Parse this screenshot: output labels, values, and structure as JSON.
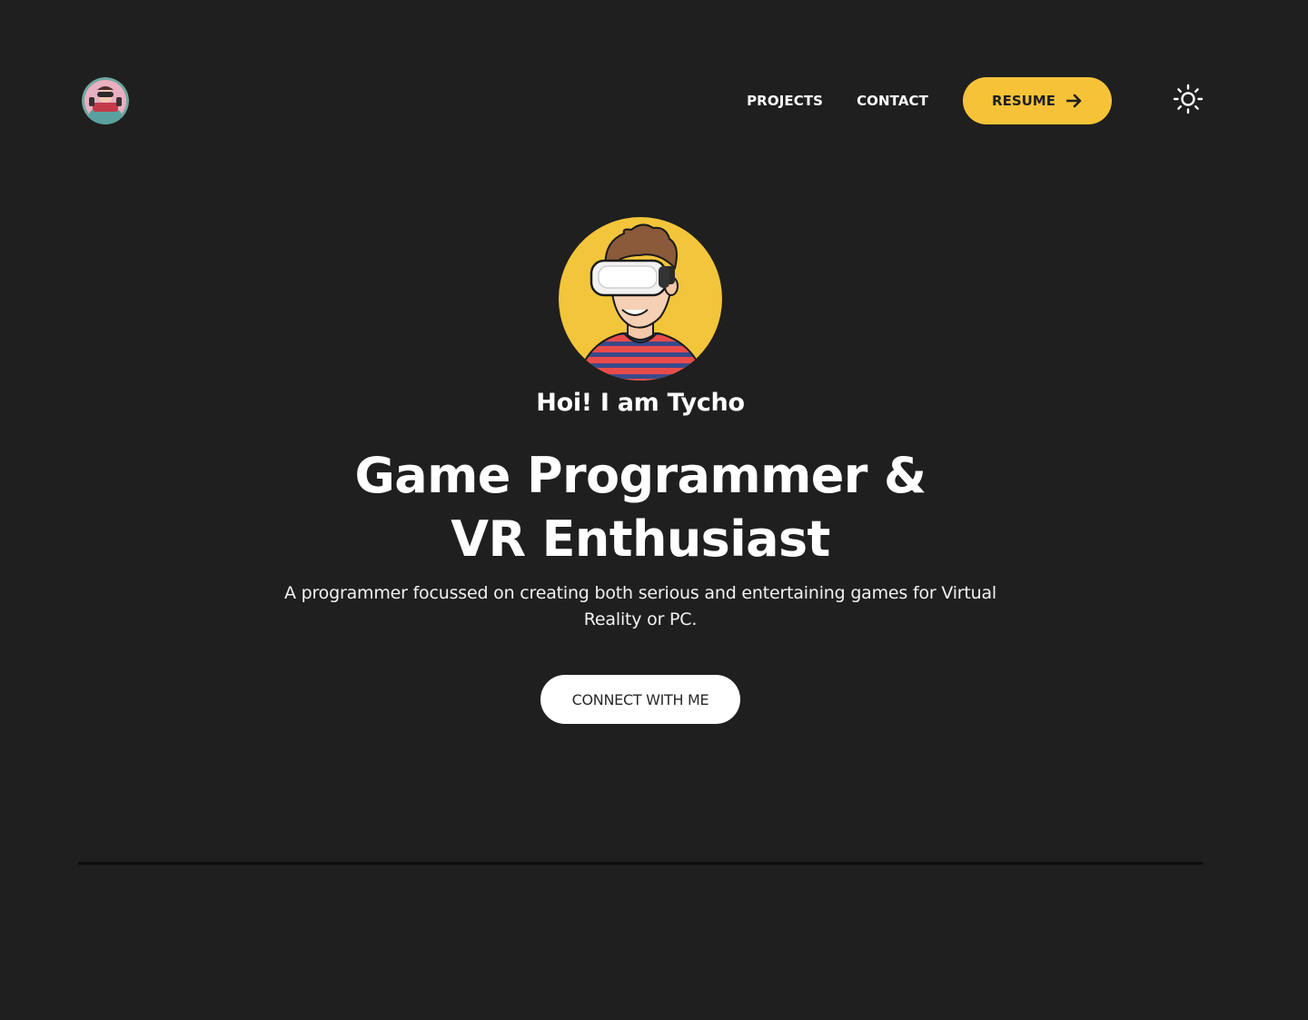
{
  "header": {
    "logo_icon": "avatar-logo-icon",
    "nav": {
      "projects_label": "PROJECTS",
      "contact_label": "CONTACT"
    },
    "resume": {
      "label": "RESUME",
      "icon": "arrow-right-icon"
    },
    "theme_toggle_icon": "sun-icon"
  },
  "hero": {
    "avatar_icon": "vr-headset-avatar",
    "greeting": "Hoi! I am Tycho",
    "headline_line1": "Game Programmer &",
    "headline_line2": "VR Enthusiast",
    "subtitle": "A programmer focussed on creating both serious and entertaining games for Virtual Reality or PC.",
    "cta_label": "CONNECT WITH ME"
  },
  "colors": {
    "background": "#1f1f1f",
    "accent": "#f6c338",
    "text": "#ffffff",
    "divider": "#0c0c0c"
  }
}
